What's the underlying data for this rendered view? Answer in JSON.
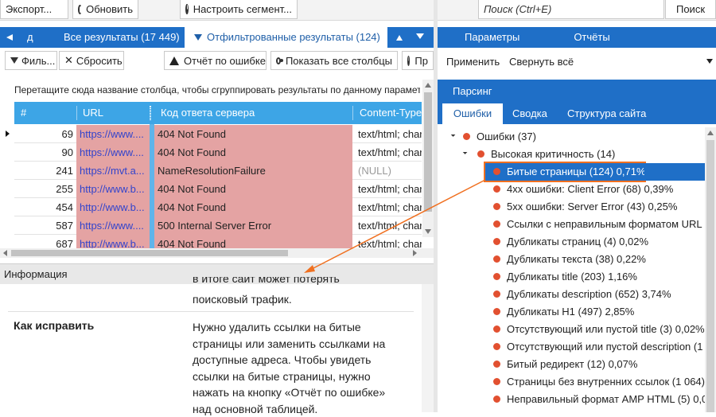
{
  "toolbar": {
    "export": "Экспорт...",
    "refresh": "Обновить",
    "segment": "Настроить сегмент...",
    "search_placeholder": "Поиск (Ctrl+E)",
    "search_button": "Поиск"
  },
  "left_tabs": {
    "truncated": "д",
    "all": "Все результаты (17 449)",
    "filtered": "Отфильтрованные результаты (124)"
  },
  "actions": {
    "filter": "Филь...",
    "reset": "Сбросить",
    "error_report": "Отчёт по ошибке",
    "show_columns": "Показать все столбцы",
    "more": "Пр"
  },
  "group_hint": "Перетащите сюда название столбца, чтобы сгруппировать результаты по данному парамет",
  "grid": {
    "columns": [
      "#",
      "URL",
      "Код ответа сервера",
      "Content-Type"
    ],
    "rows": [
      {
        "num": "69",
        "url": "https://www....",
        "code": "404 Not Found",
        "ctype": "text/html; char"
      },
      {
        "num": "90",
        "url": "https://www....",
        "code": "404 Not Found",
        "ctype": "text/html; char"
      },
      {
        "num": "241",
        "url": "https://mvt.a...",
        "code": "NameResolutionFailure",
        "ctype": "(NULL)"
      },
      {
        "num": "255",
        "url": "http://www.b...",
        "code": "404 Not Found",
        "ctype": "text/html; char"
      },
      {
        "num": "454",
        "url": "http://www.b...",
        "code": "404 Not Found",
        "ctype": "text/html; char"
      },
      {
        "num": "587",
        "url": "https://www....",
        "code": "500 Internal Server Error",
        "ctype": "text/html; char"
      },
      {
        "num": "687",
        "url": "http://www.b...",
        "code": "404 Not Found",
        "ctype": "text/html; char"
      }
    ]
  },
  "info": {
    "header": "Информация",
    "top_text_1": "в итоге сайт может потерять",
    "top_text_2": "поисковый трафик.",
    "fix_label": "Как исправить",
    "fix_lines": [
      "Нужно удалить ссылки на битые",
      "страницы или заменить ссылками на",
      "доступные адреса. Чтобы увидеть",
      "ссылки на битые страницы, нужно",
      "нажать на кнопку «Отчёт по ошибке»",
      "над основной таблицей."
    ]
  },
  "right_tabs": {
    "params": "Параметры",
    "reports": "Отчёты"
  },
  "right_actions": {
    "apply": "Применить",
    "collapse": "Свернуть всё"
  },
  "parsing": "Парсинг",
  "sub_tabs": {
    "errors": "Ошибки",
    "summary": "Сводка",
    "structure": "Структура сайта"
  },
  "tree": {
    "root": "Ошибки (37)",
    "group": "Высокая критичность (14)",
    "items": [
      "Битые страницы (124) 0,71%",
      "4xx ошибки: Client Error (68) 0,39%",
      "5xx ошибки: Server Error (43) 0,25%",
      "Ссылки с неправильным форматом URL (4",
      "Дубликаты страниц (4) 0,02%",
      "Дубликаты текста (38) 0,22%",
      "Дубликаты title (203) 1,16%",
      "Дубликаты description (652) 3,74%",
      "Дубликаты H1 (497) 2,85%",
      "Отсутствующий или пустой title (3) 0,02%",
      "Отсутствующий или пустой description (1 0",
      "Битый редирект (12) 0,07%",
      "Страницы без внутренних ссылок (1 064)",
      "Неправильный формат AMP HTML (5) 0,03"
    ]
  },
  "colors": {
    "accent": "#1f6fc7",
    "grid_header": "#3da5e6",
    "error_row": "#e4a3a3",
    "error_dot": "#e25030",
    "callout": "#f07020"
  }
}
